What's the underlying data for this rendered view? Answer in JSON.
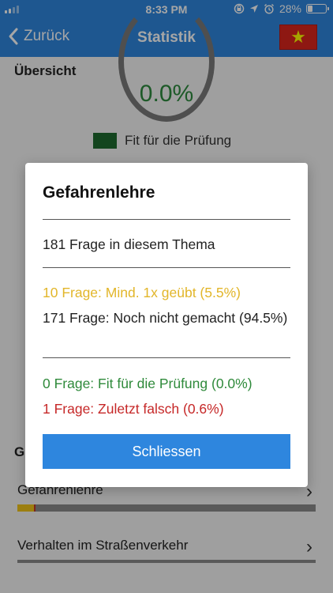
{
  "status_bar": {
    "time": "8:33 PM",
    "battery_text": "28%",
    "battery_level": 0.28,
    "icons": [
      "signal-icon",
      "rotation-lock-icon",
      "location-icon",
      "alarm-icon",
      "battery-icon"
    ]
  },
  "nav": {
    "back_label": "Zurück",
    "title": "Statistik",
    "flag_icon": "vietnam-flag-icon"
  },
  "overview": {
    "heading": "Übersicht",
    "percent": "0.0%",
    "legend_label": "Fit für die Prüfung",
    "legend_color": "#1e6b2e"
  },
  "groups": {
    "heading_partial": "G",
    "topics": [
      {
        "label": "Gefahrenlehre",
        "progress_yellow": 0.055,
        "progress_red": 0.006
      },
      {
        "label": "Verhalten im Straßenverkehr",
        "progress_yellow": 0,
        "progress_red": 0
      }
    ]
  },
  "modal": {
    "title": "Gefahrenlehre",
    "total": "181 Frage in diesem Thema",
    "practiced": "10 Frage: Mind. 1x geübt (5.5%)",
    "not_done": "171 Frage: Noch nicht gemacht (94.5%)",
    "fit": "0 Frage: Fit für die Prüfung (0.0%)",
    "wrong": "1 Frage: Zuletzt falsch (0.6%)",
    "close_label": "Schliessen"
  },
  "colors": {
    "primary": "#2e86de",
    "yellow": "#e2b62a",
    "green": "#2f8a3b",
    "red": "#c62828"
  }
}
